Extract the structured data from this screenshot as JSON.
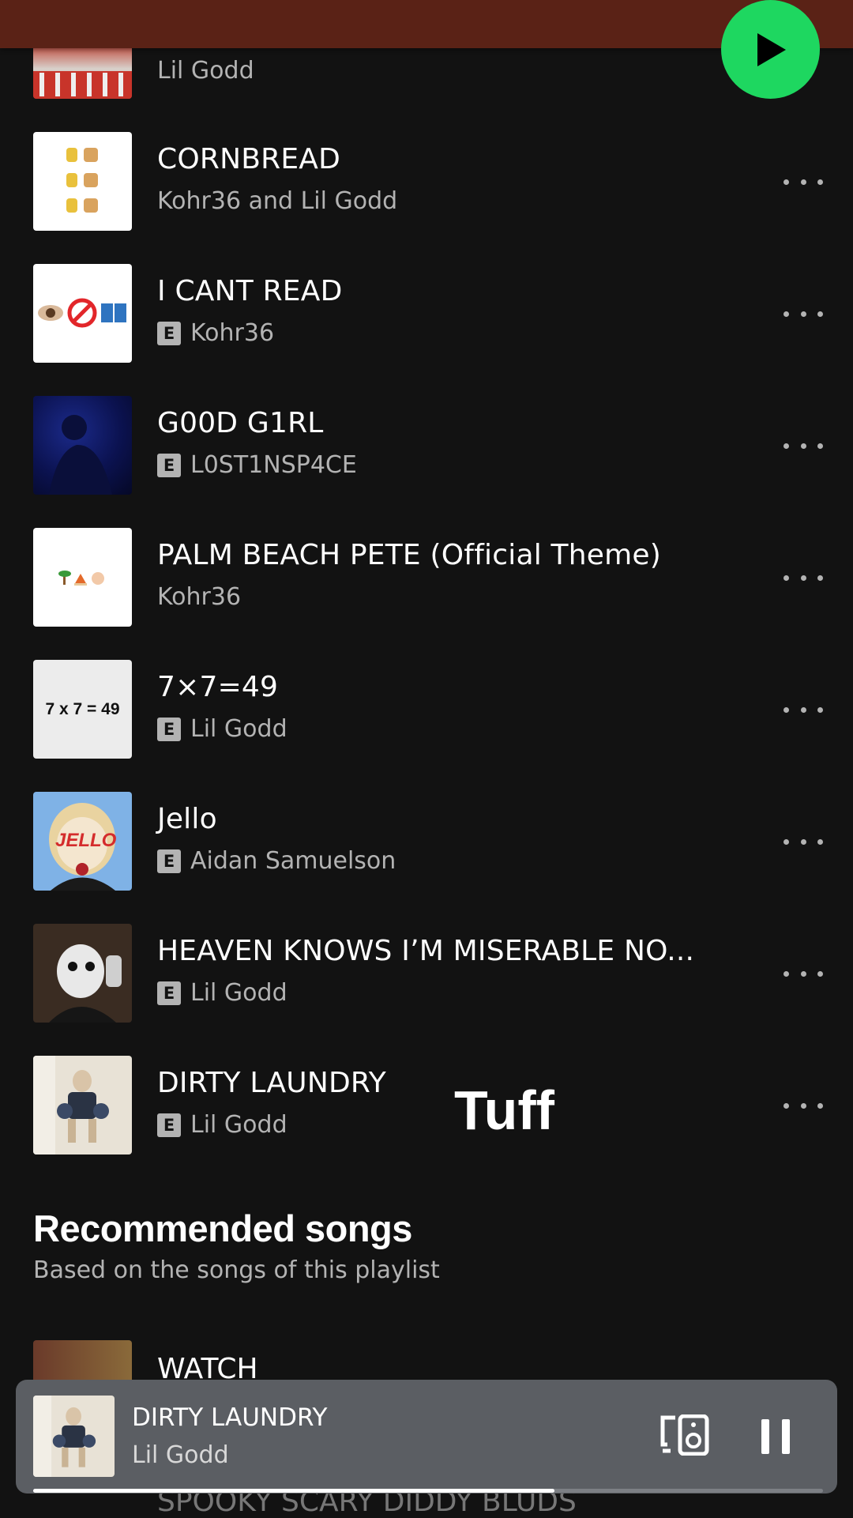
{
  "colors": {
    "background": "#121212",
    "accent_green": "#1ed760",
    "header": "#5a2216",
    "muted_text": "#b3b3b3",
    "mini_player": "#5b5e63"
  },
  "header": {
    "play_icon": "play-icon"
  },
  "tracks": [
    {
      "title": "",
      "artist": "Lil Godd",
      "explicit": false
    },
    {
      "title": "CORNBREAD",
      "artist": "Kohr36 and Lil Godd",
      "explicit": false
    },
    {
      "title": "I CANT READ",
      "artist": "Kohr36",
      "explicit": true
    },
    {
      "title": "G00D G1RL",
      "artist": "L0ST1NSP4CE",
      "explicit": true
    },
    {
      "title": "PALM BEACH PETE (Official Theme)",
      "artist": "Kohr36",
      "explicit": false
    },
    {
      "title": "7×7=49",
      "artist": "Lil Godd",
      "explicit": true,
      "cover_text": "7 x 7 = 49"
    },
    {
      "title": "Jello",
      "artist": "Aidan Samuelson",
      "explicit": true,
      "cover_text": "JELLO"
    },
    {
      "title": "HEAVEN KNOWS I’M MISERABLE NO...",
      "artist": "Lil Godd",
      "explicit": true
    },
    {
      "title": "DIRTY LAUNDRY",
      "artist": "Lil Godd",
      "explicit": true
    }
  ],
  "explicit_badge": "E",
  "overlay_text": "Tuff",
  "recommended": {
    "title": "Recommended songs",
    "subtitle": "Based on the songs of this playlist",
    "first_track": "WATCH",
    "second_track": "SPOOKY SCARY DIDDY BLUDS"
  },
  "now_playing": {
    "title": "DIRTY LAUNDRY",
    "artist": "Lil Godd",
    "progress": 0.66,
    "device_icon": "connect-device-icon",
    "pause_icon": "pause-icon"
  }
}
